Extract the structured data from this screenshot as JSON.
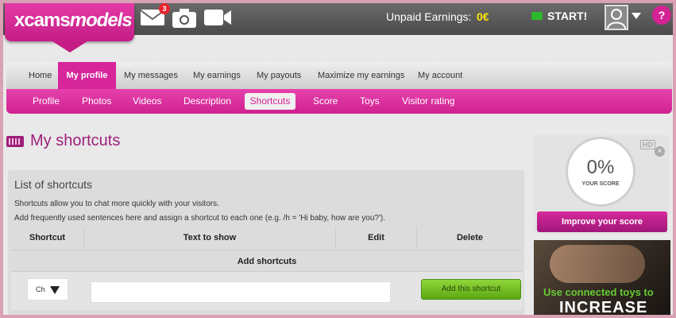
{
  "brand": {
    "logo_part1": "xcams",
    "logo_part2": "models",
    "accent": "#d7259a"
  },
  "header": {
    "messages_badge": "3",
    "unpaid_label": "Unpaid Earnings:",
    "unpaid_value": "0€",
    "start_label": "START!",
    "help_label": "?"
  },
  "main_nav": [
    "Home",
    "My profile",
    "My messages",
    "My earnings",
    "My payouts",
    "Maximize my earnings",
    "My account"
  ],
  "main_nav_active": "My profile",
  "sub_nav": [
    "Profile",
    "Photos",
    "Videos",
    "Description",
    "Shortcuts",
    "Score",
    "Toys",
    "Visitor rating"
  ],
  "sub_nav_active": "Shortcuts",
  "page": {
    "title": "My shortcuts"
  },
  "panel": {
    "title": "List of shortcuts",
    "line1": "Shortcuts allow you to chat more quickly with your visitors.",
    "line2": "Add frequently used sentences here and assign a shortcut to each one (e.g. /h = 'Hi baby, how are you?').",
    "columns": [
      "Shortcut",
      "Text to show",
      "Edit",
      "Delete"
    ],
    "add_row_label": "Add shortcuts",
    "shortcut_select_value": "Ch",
    "add_button": "Add this shortcut"
  },
  "score": {
    "percent": "0%",
    "label": "YOUR SCORE",
    "hd": "HD",
    "improve_button": "Improve your score"
  },
  "promo": {
    "line1": "Use connected toys to",
    "line2": "INCREASE"
  }
}
